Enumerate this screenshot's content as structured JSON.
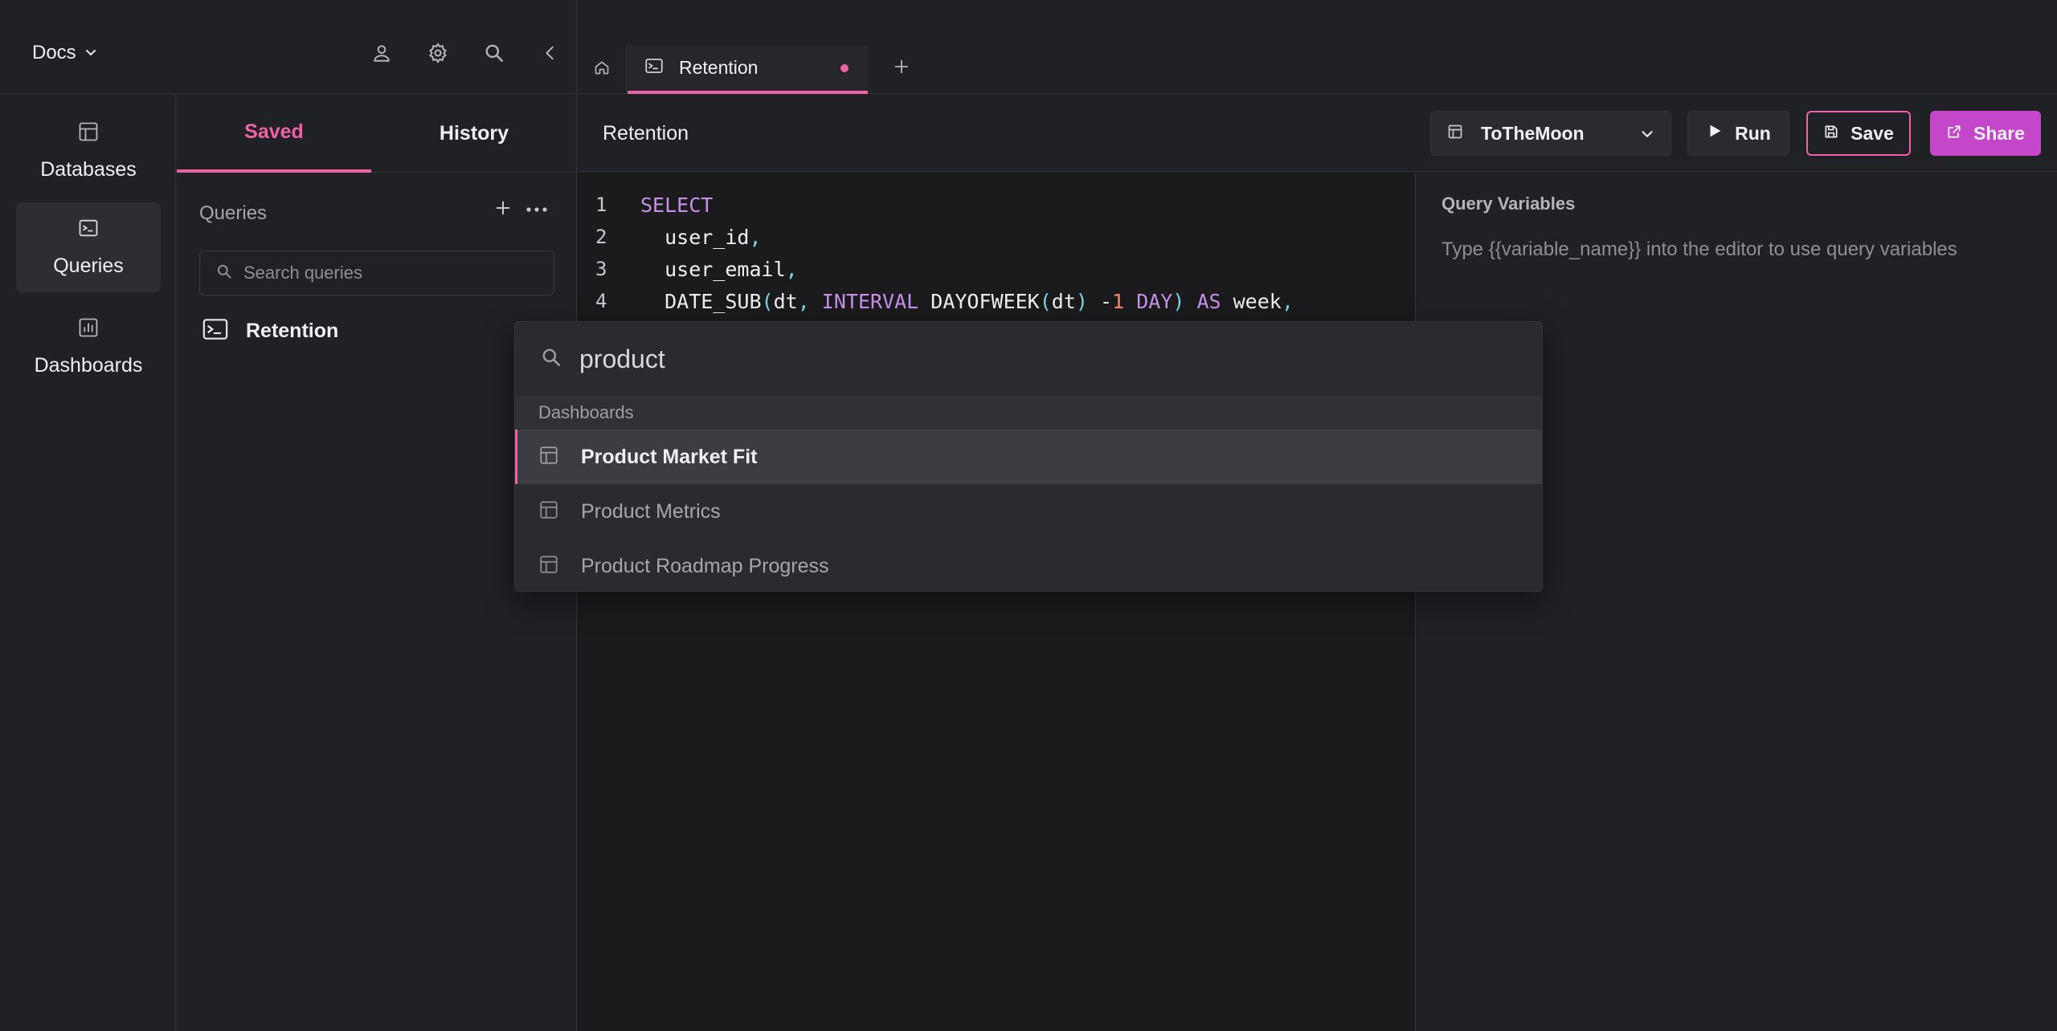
{
  "workspace": {
    "name": "Docs"
  },
  "nav": {
    "items": [
      {
        "label": "Databases",
        "icon": "table-icon",
        "active": false
      },
      {
        "label": "Queries",
        "icon": "terminal-icon",
        "active": true
      },
      {
        "label": "Dashboards",
        "icon": "chart-icon",
        "active": false
      }
    ]
  },
  "panel": {
    "tabs": {
      "saved": "Saved",
      "history": "History"
    },
    "queries_label": "Queries",
    "search_placeholder": "Search queries",
    "items": [
      {
        "label": "Retention"
      }
    ]
  },
  "tabs": {
    "open": [
      {
        "label": "Retention",
        "unsaved": true
      }
    ]
  },
  "toolbar": {
    "title": "Retention",
    "database": "ToTheMoon",
    "run_label": "Run",
    "save_label": "Save",
    "share_label": "Share"
  },
  "editor": {
    "line_numbers": [
      "1",
      "2",
      "3",
      "4"
    ],
    "lines": [
      [
        {
          "t": "SELECT",
          "k": "kw"
        }
      ],
      [
        {
          "t": "  user_id",
          "k": "id"
        },
        {
          "t": ",",
          "k": "pu"
        }
      ],
      [
        {
          "t": "  user_email",
          "k": "id"
        },
        {
          "t": ",",
          "k": "pu"
        }
      ],
      [
        {
          "t": "  DATE_SUB",
          "k": "id"
        },
        {
          "t": "(",
          "k": "pu"
        },
        {
          "t": "dt",
          "k": "id"
        },
        {
          "t": ", ",
          "k": "pu"
        },
        {
          "t": "INTERVAL",
          "k": "kw"
        },
        {
          "t": " DAYOFWEEK",
          "k": "id"
        },
        {
          "t": "(",
          "k": "pu"
        },
        {
          "t": "dt",
          "k": "id"
        },
        {
          "t": ")",
          "k": "pu"
        },
        {
          "t": " -",
          "k": "id"
        },
        {
          "t": "1",
          "k": "num"
        },
        {
          "t": " DAY",
          "k": "kw"
        },
        {
          "t": ")",
          "k": "pu"
        },
        {
          "t": " AS",
          "k": "kw"
        },
        {
          "t": " week",
          "k": "id"
        },
        {
          "t": ",",
          "k": "pu"
        }
      ]
    ]
  },
  "variables": {
    "heading": "Query Variables",
    "hint": "Type {{variable_name}} into the editor to use query variables"
  },
  "palette": {
    "query": "product",
    "section": "Dashboards",
    "results": [
      {
        "label": "Product Market Fit",
        "active": true
      },
      {
        "label": "Product Metrics",
        "active": false
      },
      {
        "label": "Product Roadmap Progress",
        "active": false
      }
    ]
  },
  "colors": {
    "accent": "#f062a8",
    "share": "#c447c9",
    "background": "#202124",
    "editor_bg": "#1b1b1d"
  }
}
